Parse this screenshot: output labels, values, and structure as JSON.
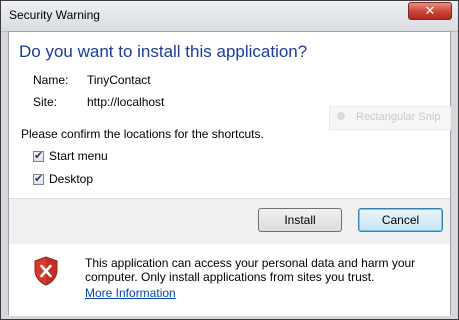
{
  "window": {
    "title": "Security Warning",
    "close_glyph": "✕"
  },
  "dialog": {
    "heading": "Do you want to install this application?",
    "name_label": "Name:",
    "name_value": "TinyContact",
    "site_label": "Site:",
    "site_value": "http://localhost",
    "confirm_text": "Please confirm the locations for the shortcuts.",
    "shortcuts": [
      {
        "label": "Start menu",
        "checked": true
      },
      {
        "label": "Desktop",
        "checked": true
      }
    ],
    "overlay_hint": "Rectangular Snip"
  },
  "buttons": {
    "install": "Install",
    "cancel": "Cancel"
  },
  "warning": {
    "text": "This application can access your personal data and harm your computer. Only install applications from sites you trust.",
    "link": "More Information"
  },
  "colors": {
    "heading": "#1a3c9a",
    "link": "#0645ad",
    "shield": "#d33b2f",
    "close": "#c84536"
  },
  "icons": [
    "close-icon",
    "checkbox-checked-icon",
    "shield-warning-icon"
  ]
}
